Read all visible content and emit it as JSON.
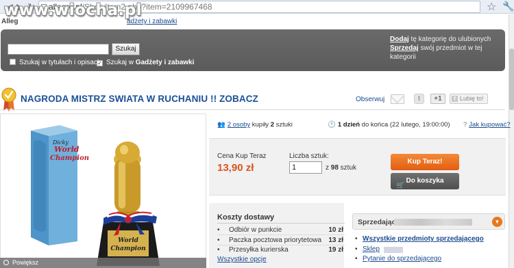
{
  "browser": {
    "url_host": "allegro.pl",
    "url_path": "/ShowItem2.php?item=2109967468"
  },
  "watermark": {
    "text": "www.wiocha.pl"
  },
  "breadcrumb": {
    "lead": "Alleg",
    "link": "adżety i zabawki"
  },
  "search": {
    "input_value": "",
    "button_label": "Szukaj",
    "opt_titles_label": "Szukaj w tytułach i opisach",
    "opt_category_prefix": "Szukaj w ",
    "opt_category_name": "Gadżety i zabawki",
    "opt_category_checked_mark": "✓"
  },
  "favorites": {
    "add_link": "Dodaj",
    "add_text": " tę kategorię do ulubionych",
    "sell_link": "Sprzedaj",
    "sell_text": " swój przedmiot w tej kategorii"
  },
  "item": {
    "title": "NAGRODA MISTRZ SWIATA W RUCHANIU !! ZOBACZ",
    "observe_label": "Obserwuj",
    "plus_label": "+1",
    "fb_label": "Lubię to!",
    "zoom_label": "Powiększ",
    "box_text_1": "Dicky",
    "box_text_2": "World",
    "box_text_3": "Champion",
    "plaque_text_1": "World",
    "plaque_text_2": "Champion"
  },
  "stats": {
    "buyers_link": "2 osoby",
    "buyers_text": " kupiły ",
    "buyers_qty": "2",
    "buyers_unit": " sztuki",
    "time_bold": "1 dzień",
    "time_text": " do końca (22 lutego, 19:00:00)",
    "how_link": "Jak kupować?"
  },
  "buy": {
    "price_label": "Cena Kup Teraz",
    "price": "13,90 zł",
    "qty_label": "Liczba sztuk:",
    "qty_value": "1",
    "qty_of_prefix": "z ",
    "qty_available": "98",
    "qty_unit": " sztuk",
    "buy_now_label": "Kup Teraz!",
    "cart_label": "Do koszyka"
  },
  "delivery": {
    "title": "Koszty dostawy",
    "rows": [
      {
        "name": "Odbiór w punkcie",
        "cost": "10 zł"
      },
      {
        "name": "Paczka pocztowa priorytetowa",
        "cost": "13 zł"
      },
      {
        "name": "Przesyłka kurierska",
        "cost": "19 zł"
      }
    ],
    "all_options": "Wszystkie opcje"
  },
  "seller": {
    "label": "Sprzedający",
    "links": [
      "Wszystkie przedmioty sprzedającego",
      "Sklep",
      "Pytanie do sprzedającego"
    ]
  },
  "colors": {
    "title_blue": "#1b4f97",
    "price_orange": "#d9541e",
    "buy_orange": "#e35d10",
    "searchbar_gray": "#5b5b5b"
  }
}
